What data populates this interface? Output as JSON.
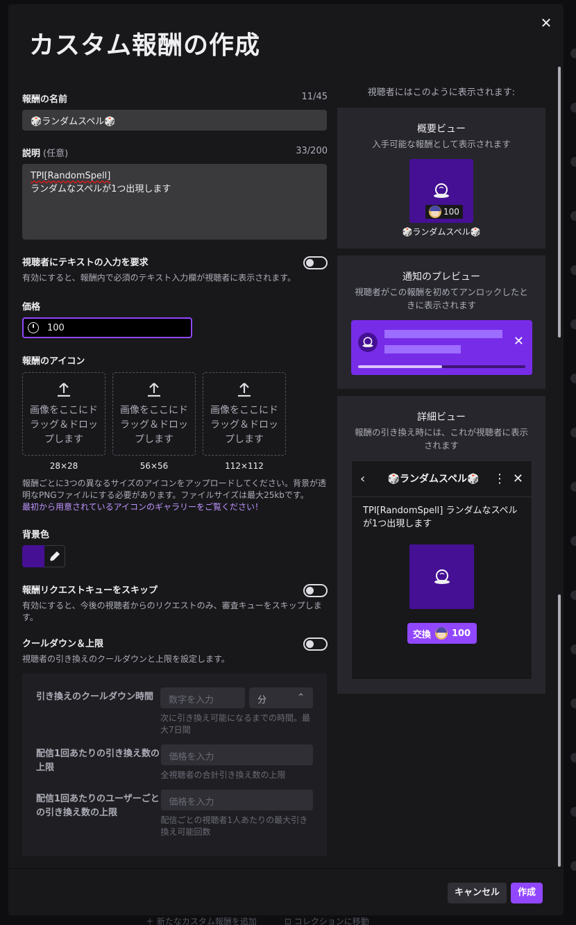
{
  "modal": {
    "title": "カスタム報酬の作成",
    "close_icon": "close-icon"
  },
  "form": {
    "name": {
      "label": "報酬の名前",
      "count": "11/45",
      "value": "🎲ランダムスペル🎲"
    },
    "description": {
      "label": "説明",
      "optional": "(任意)",
      "count": "33/200",
      "value_line1": "TPI[RandomSpell]",
      "value_line2": "ランダムなスペルが1つ出現します"
    },
    "require_text": {
      "label": "視聴者にテキストの入力を要求",
      "hint": "有効にすると、報酬内で必須のテキスト入力欄が視聴者に表示されます。",
      "enabled": false
    },
    "price": {
      "label": "価格",
      "value": "100"
    },
    "icon": {
      "label": "報酬のアイコン",
      "slots": [
        {
          "text": "画像をここにドラッグ＆ドロップします",
          "size": "28×28"
        },
        {
          "text": "画像をここにドラッグ＆ドロップします",
          "size": "56×56"
        },
        {
          "text": "画像をここにドラッグ＆ドロップします",
          "size": "112×112"
        }
      ],
      "hint": "報酬ごとに3つの異なるサイズのアイコンをアップロードしてください。背景が透明なPNGファイルにする必要があります。ファイルサイズは最大25kbです。",
      "gallery_link": "最初から用意されているアイコンのギャラリーをご覧ください！"
    },
    "background": {
      "label": "背景色",
      "color": "#451093"
    },
    "skip_queue": {
      "label": "報酬リクエストキューをスキップ",
      "hint": "有効にすると、今後の視聴者からのリクエストのみ、審査キューをスキップします。",
      "enabled": false
    },
    "cooldown": {
      "label": "クールダウン＆上限",
      "hint": "視聴者の引き換えのクールダウンと上限を設定します。",
      "enabled": false
    },
    "limits": [
      {
        "label": "引き換えのクールダウン時間",
        "placeholder": "数字を入力",
        "unit": "分",
        "hint": "次に引き換え可能になるまでの時間。最大7日間"
      },
      {
        "label": "配信1回あたりの引き換え数の上限",
        "placeholder": "価格を入力",
        "hint": "全視聴者の合計引き換え数の上限"
      },
      {
        "label": "配信1回あたりのユーザーごとの引き換え数の上限",
        "placeholder": "価格を入力",
        "hint": "配信ごとの視聴者1人あたりの最大引き換え可能回数"
      }
    ]
  },
  "preview": {
    "lead": "視聴者にはこのように表示されます:",
    "summary": {
      "title": "概要ビュー",
      "sub": "入手可能な報酬として表示されます",
      "cost": "100",
      "name": "🎲ランダムスペル🎲"
    },
    "notification": {
      "title": "通知のプレビュー",
      "sub": "視聴者がこの報酬を初めてアンロックしたときに表示されます",
      "progress": 0.5
    },
    "detail": {
      "title": "詳細ビュー",
      "sub": "報酬の引き換え時には、これが視聴者に表示されます",
      "header": "🎲ランダムスペル🎲",
      "desc": "TPI[RandomSpell] ランダムなスペルが1つ出現します",
      "redeem_label": "交換",
      "cost": "100"
    }
  },
  "footer": {
    "cancel": "キャンセル",
    "create": "作成"
  },
  "background_page": {
    "footer_left": "新たなカスタム報酬を追加",
    "footer_right": "コレクションに移動"
  },
  "colors": {
    "accent": "#9147ff",
    "reward_bg": "#451093",
    "notif_bg": "#772ce8"
  }
}
